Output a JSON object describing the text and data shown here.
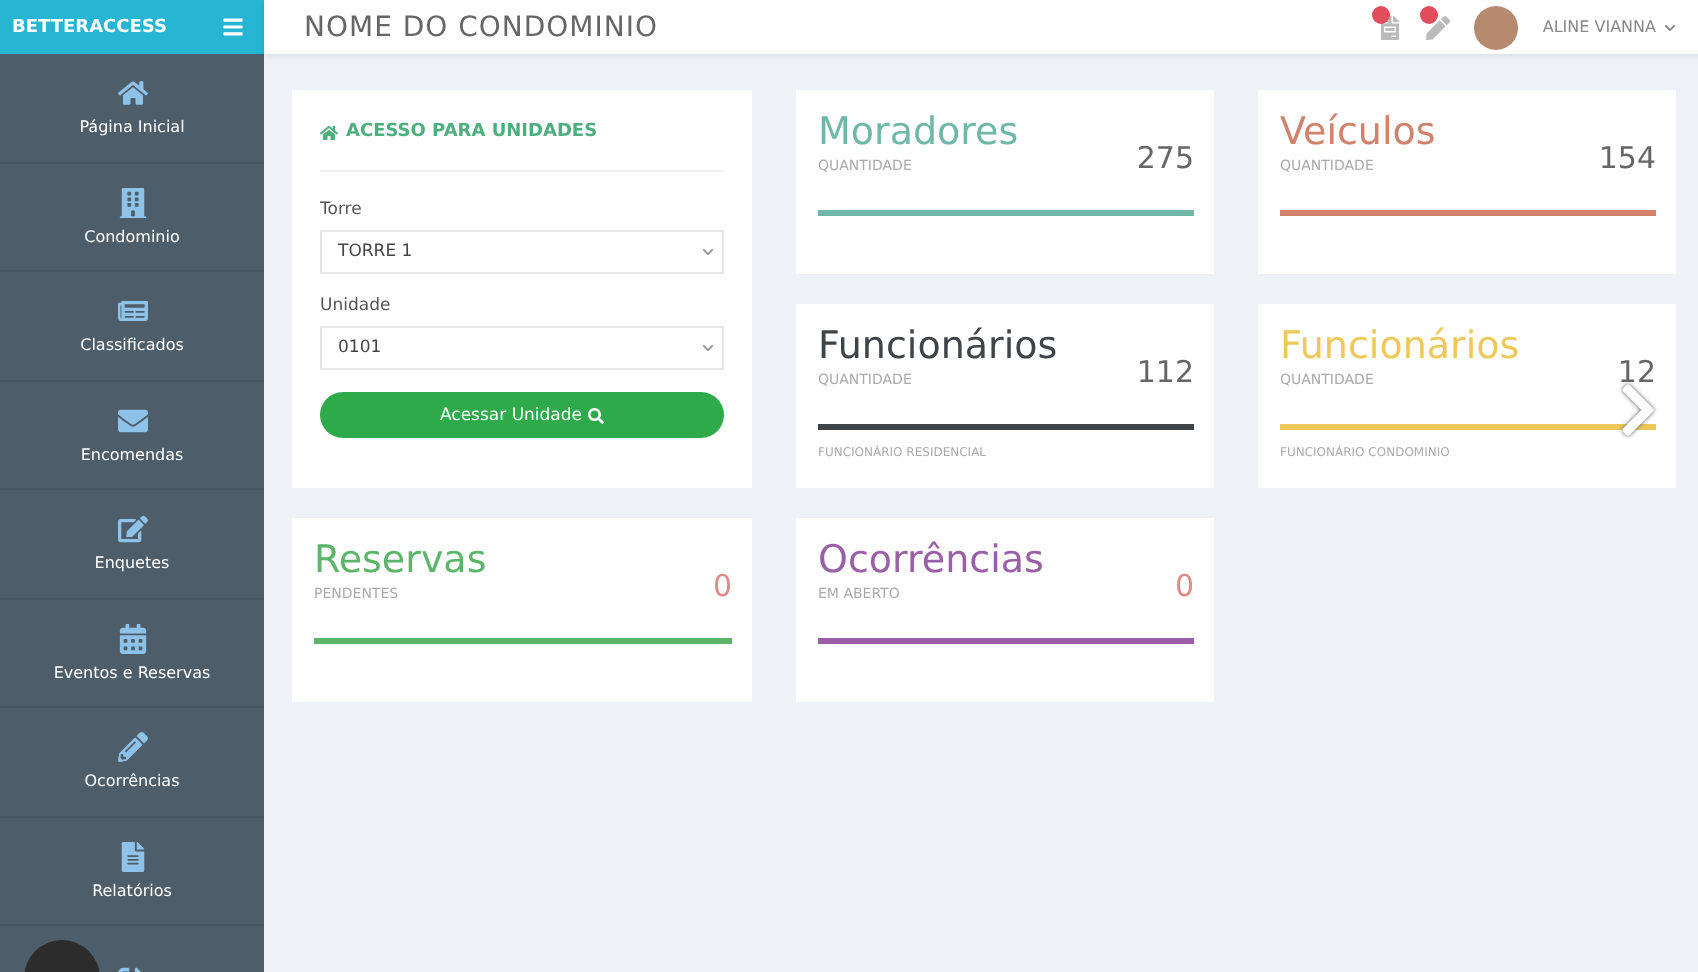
{
  "brand": "BETTERACCESS",
  "header": {
    "title": "NOME DO CONDOMINIO",
    "user": "ALINE VIANNA"
  },
  "sidebar": {
    "items": [
      {
        "label": "Página Inicial",
        "selected": false
      },
      {
        "label": "Condominio",
        "selected": false
      },
      {
        "label": "Classificados",
        "selected": false
      },
      {
        "label": "Encomendas",
        "selected": false
      },
      {
        "label": "Enquetes",
        "selected": false
      },
      {
        "label": "Eventos e Reservas",
        "selected": false
      },
      {
        "label": "Ocorrências",
        "selected": false
      },
      {
        "label": "Relatórios",
        "selected": false
      },
      {
        "selected": false
      }
    ]
  },
  "access_panel": {
    "title": "ACESSO PARA UNIDADES",
    "fields": [
      {
        "label": "Torre",
        "value": "TORRE 1"
      },
      {
        "label": "Unidade",
        "value": "0101"
      }
    ],
    "button": "Acessar Unidade"
  },
  "stats": [
    {
      "title": "Moradores",
      "subtitle": "QUANTIDADE",
      "value": "275",
      "color": "#6fb8a8",
      "alert": false
    },
    {
      "title": "Veículos",
      "subtitle": "QUANTIDADE",
      "value": "154",
      "color": "#d0836a",
      "alert": false
    },
    {
      "title": "Funcionários",
      "subtitle": "QUANTIDADE",
      "value": "112",
      "color": "#3f4448",
      "alert": false,
      "footer": "FUNCIONÁRIO RESIDENCIAL"
    },
    {
      "title": "Funcionários",
      "subtitle": "QUANTIDADE",
      "value": "12",
      "color": "#efc85a",
      "alert": false,
      "footer": "FUNCIONÁRIO CONDOMINIO"
    },
    {
      "title": "Reservas",
      "subtitle": "PENDENTES",
      "value": "0",
      "color": "#5cb56a",
      "alert": true
    },
    {
      "title": "Ocorrências",
      "subtitle": "EM ABERTO",
      "value": "0",
      "color": "#9a5fa8",
      "alert": true
    }
  ]
}
